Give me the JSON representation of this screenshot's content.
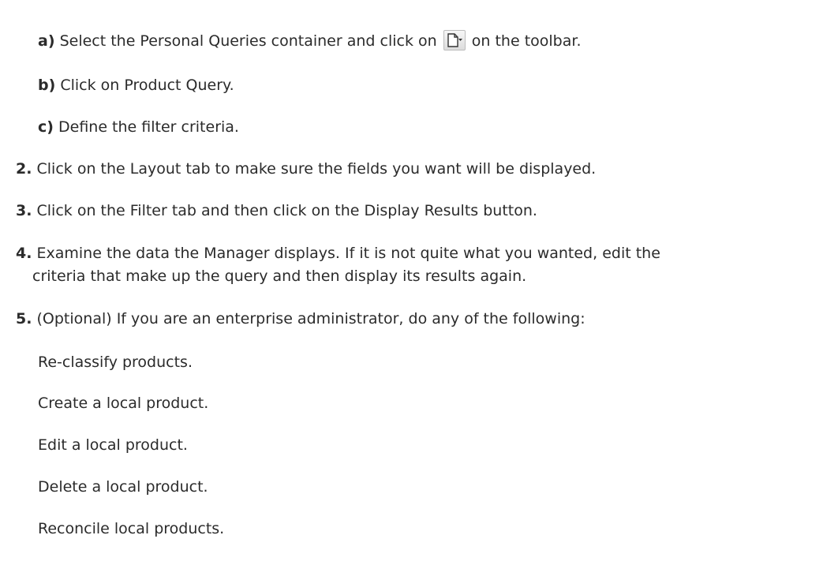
{
  "steps": {
    "a": {
      "marker": "a)",
      "text_before": "Select the Personal Queries container and click on",
      "icon": "new-document-dropdown-icon",
      "text_after": "on the toolbar."
    },
    "b": {
      "marker": "b)",
      "text": "Click on Product Query."
    },
    "c": {
      "marker": "c)",
      "text": "Define the filter criteria."
    },
    "s2": {
      "marker": "2.",
      "text": "Click on the Layout tab to make sure the fields you want will be displayed."
    },
    "s3": {
      "marker": "3.",
      "text": "Click on the Filter tab and then click on the Display Results button."
    },
    "s4": {
      "marker": "4.",
      "text": "Examine the data the Manager displays. If it is not quite what you wanted, edit the",
      "text_cont": "criteria that make up the query and then display its results again."
    },
    "s5": {
      "marker": "5.",
      "text": "(Optional) If you are an enterprise administrator, do any of the following:"
    }
  },
  "options": [
    "Re-classify products.",
    "Create a local product.",
    "Edit a local product.",
    "Delete a local product.",
    "Reconcile local products."
  ]
}
